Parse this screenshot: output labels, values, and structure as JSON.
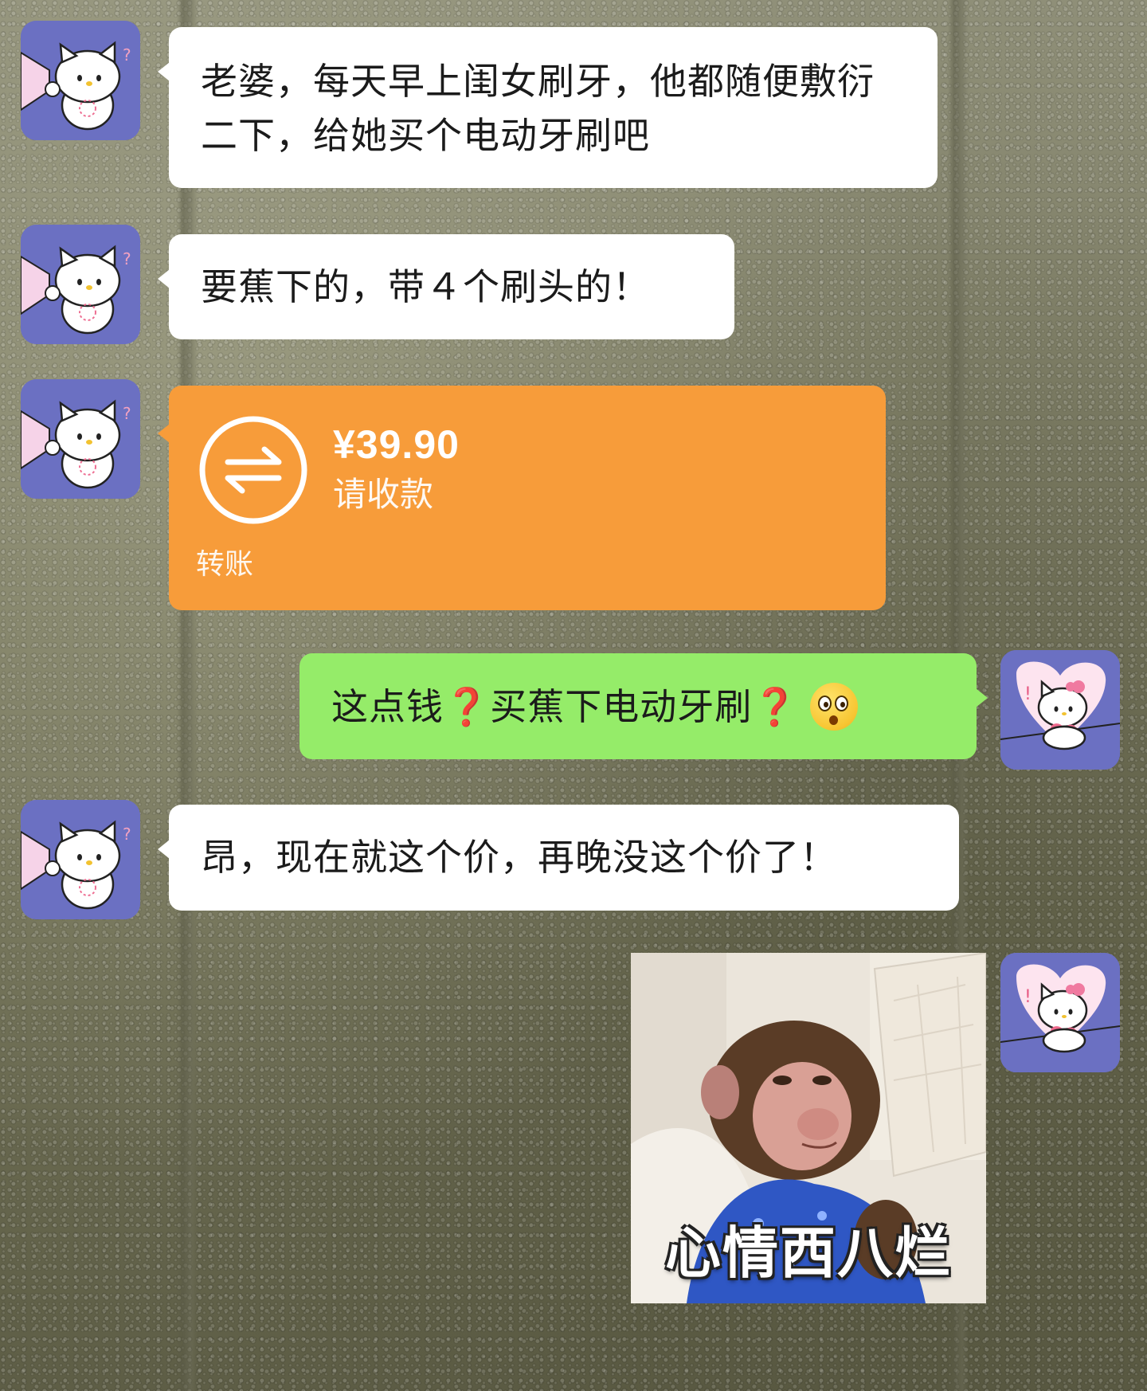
{
  "messages": [
    {
      "side": "left",
      "type": "text",
      "text": "老婆，每天早上闺女刷牙，他都随便敷衍二下，给她买个电动牙刷吧"
    },
    {
      "side": "left",
      "type": "text",
      "text": "要蕉下的，带４个刷头的！"
    },
    {
      "side": "left",
      "type": "transfer",
      "amount": "¥39.90",
      "status": "请收款",
      "footer": "转账"
    },
    {
      "side": "right",
      "type": "text",
      "parts": [
        "这点钱",
        "❓",
        "买蕉下电动牙刷",
        "❓"
      ],
      "emoji": "flushed-face"
    },
    {
      "side": "left",
      "type": "text",
      "text": "昂，现在就这个价，再晚没这个价了！"
    },
    {
      "side": "right",
      "type": "sticker",
      "caption": "心情西八烂",
      "subject": "monkey-on-sofa"
    }
  ],
  "colors": {
    "bubble_white": "#ffffff",
    "bubble_green": "#95ec69",
    "transfer_orange": "#f79c3a",
    "avatar_bg": "#6b70c2",
    "question_red": "#d8262b"
  }
}
